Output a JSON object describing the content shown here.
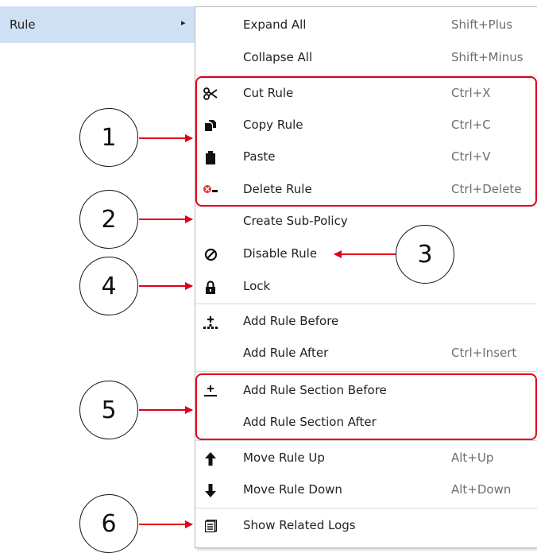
{
  "parent_menu": {
    "label": "Rule",
    "arrow": "▸"
  },
  "menu": {
    "items": [
      {
        "label": "Expand All",
        "shortcut": "Shift+Plus",
        "icon": ""
      },
      {
        "label": "Collapse All",
        "shortcut": "Shift+Minus",
        "icon": ""
      },
      {
        "label": "Cut Rule",
        "shortcut": "Ctrl+X",
        "icon": "scissors-icon"
      },
      {
        "label": "Copy Rule",
        "shortcut": "Ctrl+C",
        "icon": "copy-icon"
      },
      {
        "label": "Paste",
        "shortcut": "Ctrl+V",
        "icon": "clipboard-icon"
      },
      {
        "label": "Delete Rule",
        "shortcut": "Ctrl+Delete",
        "icon": "delete-icon"
      },
      {
        "label": "Create Sub-Policy",
        "shortcut": "",
        "icon": ""
      },
      {
        "label": "Disable Rule",
        "shortcut": "",
        "icon": "disable-icon"
      },
      {
        "label": "Lock",
        "shortcut": "",
        "icon": "lock-icon"
      },
      {
        "label": "Add Rule Before",
        "shortcut": "",
        "icon": "add-rule-icon"
      },
      {
        "label": "Add Rule After",
        "shortcut": "Ctrl+Insert",
        "icon": ""
      },
      {
        "label": "Add Rule Section Before",
        "shortcut": "",
        "icon": "add-section-icon"
      },
      {
        "label": "Add Rule Section After",
        "shortcut": "",
        "icon": ""
      },
      {
        "label": "Move Rule Up",
        "shortcut": "Alt+Up",
        "icon": "arrow-up-icon"
      },
      {
        "label": "Move Rule Down",
        "shortcut": "Alt+Down",
        "icon": "arrow-down-icon"
      },
      {
        "label": "Show Related Logs",
        "shortcut": "",
        "icon": "logs-icon"
      }
    ]
  },
  "callouts": [
    "1",
    "2",
    "3",
    "4",
    "5",
    "6"
  ],
  "colors": {
    "highlight": "#cfe0f2",
    "annotation": "#e0001b"
  }
}
